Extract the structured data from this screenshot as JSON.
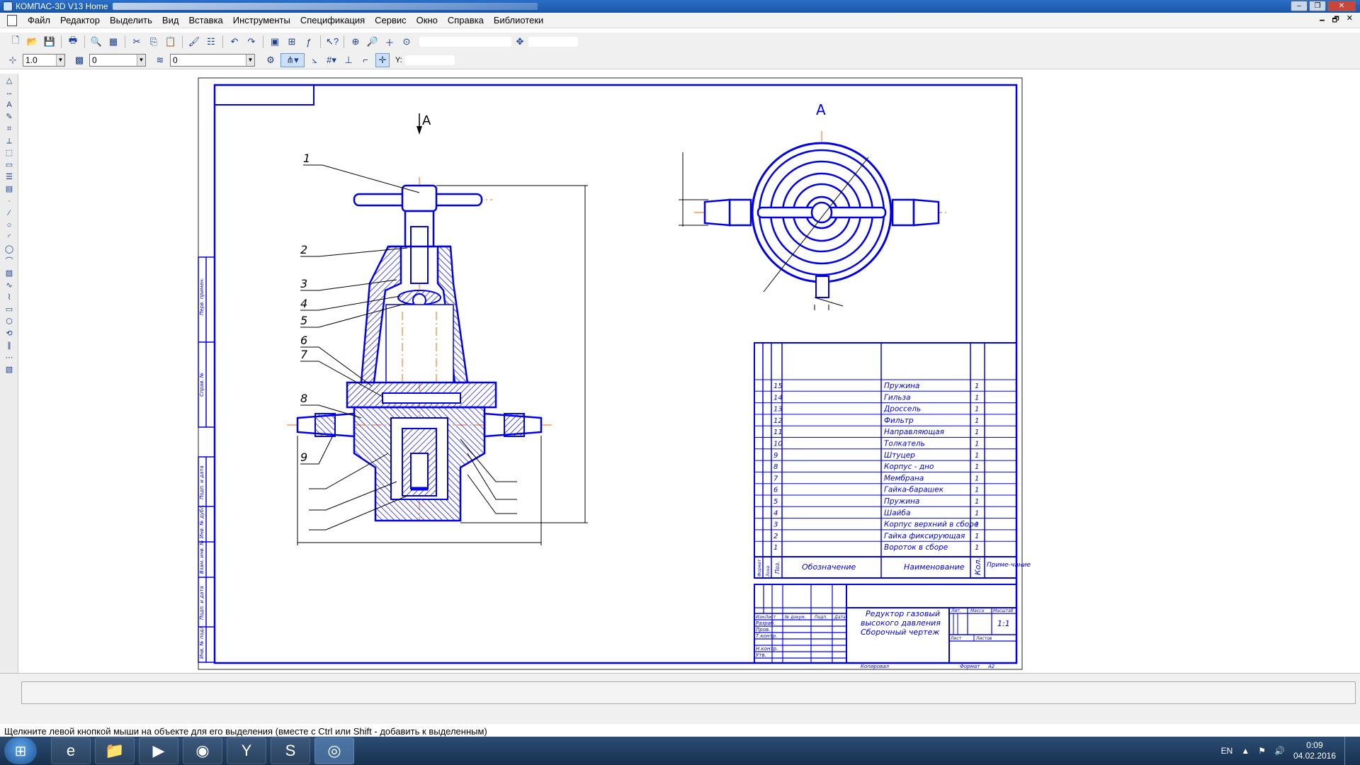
{
  "window": {
    "title": "КОМПАС-3D V13 Home"
  },
  "menu": {
    "items": [
      "Файл",
      "Редактор",
      "Выделить",
      "Вид",
      "Вставка",
      "Инструменты",
      "Спецификация",
      "Сервис",
      "Окно",
      "Справка",
      "Библиотеки"
    ]
  },
  "toolbar2": {
    "step_value": "1.0",
    "layer_value": "0",
    "style_value": "0",
    "coord_label": "Y:"
  },
  "drawing": {
    "view_label_top": "А",
    "view_label_section": "А",
    "callouts": [
      "1",
      "2",
      "3",
      "4",
      "5",
      "6",
      "7",
      "8",
      "9"
    ],
    "left_stamp": [
      "Перв. примен.",
      "Справ. №",
      "Подп. и дата",
      "Инв. № дубл.",
      "Взам. инв. №",
      "Подп. и дата",
      "Инв. № подл."
    ]
  },
  "spec_table": {
    "columns": [
      "Формат",
      "Зона",
      "Поз.",
      "Обозначение",
      "Наименование",
      "Кол.",
      "Приме-чание"
    ],
    "rows": [
      {
        "pos": "15",
        "name": "Пружина",
        "qty": "1"
      },
      {
        "pos": "14",
        "name": "Гильза",
        "qty": "1"
      },
      {
        "pos": "13",
        "name": "Дроссель",
        "qty": "1"
      },
      {
        "pos": "12",
        "name": "Фильтр",
        "qty": "1"
      },
      {
        "pos": "11",
        "name": "Направляющая",
        "qty": "1"
      },
      {
        "pos": "10",
        "name": "Толкатель",
        "qty": "1"
      },
      {
        "pos": "9",
        "name": "Штуцер",
        "qty": "1"
      },
      {
        "pos": "8",
        "name": "Корпус - дно",
        "qty": "1"
      },
      {
        "pos": "7",
        "name": "Мембрана",
        "qty": "1"
      },
      {
        "pos": "6",
        "name": "Гайка-барашек",
        "qty": "1"
      },
      {
        "pos": "5",
        "name": "Пружина",
        "qty": "1"
      },
      {
        "pos": "4",
        "name": "Шайба",
        "qty": "1"
      },
      {
        "pos": "3",
        "name": "Корпус верхний в сборе",
        "qty": "1"
      },
      {
        "pos": "2",
        "name": "Гайка фиксирующая",
        "qty": "1"
      },
      {
        "pos": "1",
        "name": "Вороток в сборе",
        "qty": "1"
      }
    ]
  },
  "title_block": {
    "name_line1": "Редуктор газовый",
    "name_line2": "высокого давления",
    "name_line3": "Сборочный чертеж",
    "col_headers": [
      "Изм.",
      "Лист",
      "№ докум.",
      "Подп.",
      "Дата"
    ],
    "roles": [
      "Разраб.",
      "Пров.",
      "Т.контр.",
      "",
      "Н.контр.",
      "Утв."
    ],
    "lit_label": "Лит.",
    "mass_label": "Масса",
    "scale_label": "Масштаб",
    "scale_value": "1:1",
    "sheet_label": "Лист",
    "sheets_label": "Листов",
    "copied_label": "Копировал",
    "format_label": "Формат",
    "format_value": "A2"
  },
  "status_bar": {
    "hint": "Щелкните левой кнопкой мыши на объекте для его выделения (вместе с Ctrl или Shift - добавить к выделенным)"
  },
  "taskbar": {
    "lang": "EN",
    "time": "0:09",
    "date": "04.02.2016"
  },
  "colors": {
    "drawing_line": "#0000e6",
    "axis_line": "#ff6600",
    "titlebar": "#1b56a8"
  }
}
